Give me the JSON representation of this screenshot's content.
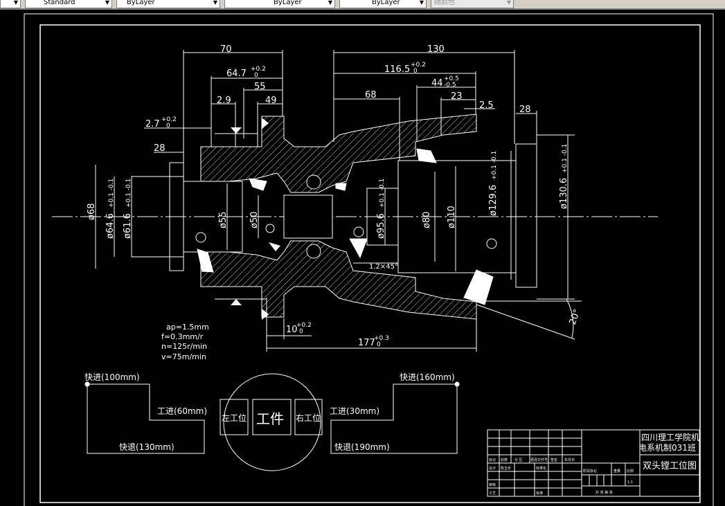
{
  "toolbar": {
    "text_style": "Standard",
    "layer_color": "ByLayer",
    "linetype": "ByLayer",
    "lineweight": "ByLayer",
    "plot_style": "随颜色"
  },
  "drawing": {
    "top_dims": {
      "d70": "70",
      "d64_7": "64.7",
      "d64_7_up": "+0.2",
      "d64_7_lo": "0",
      "d55": "55",
      "d2_9": "2.9",
      "d49": "49",
      "d2_7": "2.7",
      "d2_7_up": "+0.2",
      "d2_7_lo": "0",
      "d28_left": "28",
      "d130": "130",
      "d116_5": "116.5",
      "d116_5_up": "+0.2",
      "d116_5_lo": "0",
      "d44": "44",
      "d44_up": "+0.5",
      "d44_lo": "-0.5",
      "d68": "68",
      "d23": "23",
      "d2_5": "2.5",
      "d28_right": "28"
    },
    "diameters": {
      "phi68": "ø68",
      "phi64_6": "ø64.6",
      "phi64_6_tol": "+0.1 -0.1",
      "phi61_6": "ø61.6",
      "phi61_6_tol": "+0.1 -0.1",
      "phi55": "ø55",
      "phi50": "ø50",
      "phi95_6": "ø95.6",
      "phi95_6_tol": "+0.1 -0.1",
      "phi80": "ø80",
      "phi110": "ø110",
      "phi129_6": "ø129.6",
      "phi129_6_tol": "+0.1 -0.1",
      "phi130_6": "ø130.6",
      "phi130_6_tol": "+0.1 -0.1"
    },
    "chamfer": "1.2×45°",
    "angle": "20°",
    "bottom_dims": {
      "d10": "10",
      "d10_up": "+0.2",
      "d10_lo": "0",
      "d177": "177",
      "d177_up": "+0.3",
      "d177_lo": "0"
    },
    "cutting_params": [
      "ap=1.5mm",
      "f=0.3mm/r",
      "n=125r/min",
      "v=75m/min"
    ],
    "left_cycle": {
      "rapid_in": "快进(100mm)",
      "work_feed": "工进(60mm)",
      "rapid_out": "快退(130mm)"
    },
    "right_cycle": {
      "rapid_in": "快进(160mm)",
      "work_feed": "工进(30mm)",
      "rapid_out": "快退(190mm)"
    },
    "stations": {
      "left": "左工位",
      "workpiece": "工件",
      "right": "右工位"
    }
  },
  "title_block": {
    "school_line1": "四川理工学院机",
    "school_line2": "电系机制031班",
    "drawing_title": "双头镗工位图",
    "headers": [
      "标记",
      "处数",
      "分 区",
      "更改文件号",
      "签名",
      "年月日"
    ],
    "design": "设计",
    "designer": "陈玉冬",
    "standardization": "标准化",
    "review": "审核",
    "process": "工艺",
    "approve": "批准",
    "stage_mark": "阶段标记",
    "weight": "重量",
    "scale": "比例",
    "scale_value": "1:1",
    "sheets": "共 张 第 张"
  }
}
